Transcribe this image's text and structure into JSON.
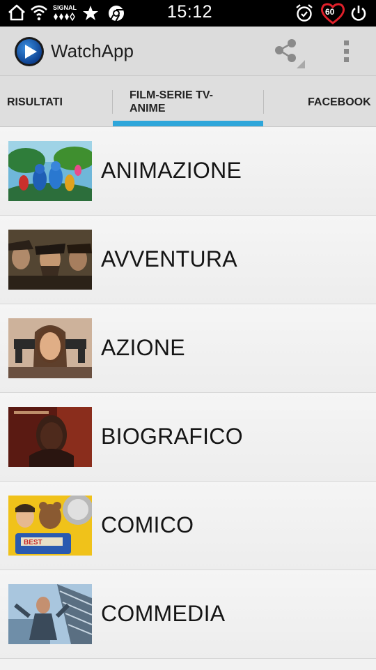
{
  "status_bar": {
    "time": "15:12",
    "signal_label": "SIGNAL",
    "battery_level": "60",
    "icons": [
      "home-icon",
      "wifi-icon",
      "signal-icon",
      "star-icon",
      "chrome-icon",
      "alarm-icon",
      "heart-battery-icon",
      "power-icon"
    ]
  },
  "app": {
    "title": "WatchApp",
    "actions": [
      "share-icon",
      "overflow-menu-icon"
    ]
  },
  "tabs": [
    {
      "label": "RISULTATI",
      "selected": false
    },
    {
      "label": "FILM-SERIE TV-\nANIME",
      "selected": true
    },
    {
      "label": "FACEBOOK",
      "selected": false
    }
  ],
  "accent_color": "#2ea6da",
  "genres": [
    {
      "label": "ANIMAZIONE"
    },
    {
      "label": "AVVENTURA"
    },
    {
      "label": "AZIONE"
    },
    {
      "label": "BIOGRAFICO"
    },
    {
      "label": "COMICO"
    },
    {
      "label": "COMMEDIA"
    }
  ]
}
